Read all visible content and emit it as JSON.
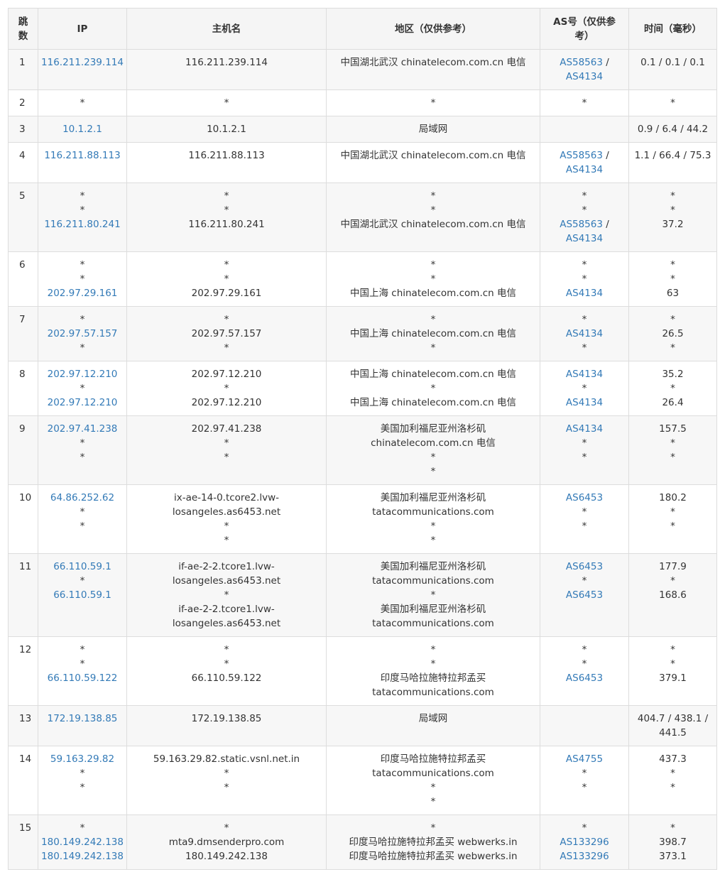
{
  "headers": {
    "hop": "跳数",
    "ip": "IP",
    "host": "主机名",
    "region": "地区（仅供参考）",
    "as": "AS号（仅供参考）",
    "time": "时间（毫秒）"
  },
  "rows": [
    {
      "hop": "1",
      "ip": [
        "116.211.239.114"
      ],
      "host": [
        "116.211.239.114"
      ],
      "region": [
        "中国湖北武汉 chinatelecom.com.cn 电信"
      ],
      "as": [
        [
          "AS58563 /",
          "AS4134"
        ]
      ],
      "time": [
        "0.1 / 0.1 / 0.1"
      ]
    },
    {
      "hop": "2",
      "ip": [
        "*"
      ],
      "host": [
        "*"
      ],
      "region": [
        "*"
      ],
      "as": [
        [
          "*"
        ]
      ],
      "time": [
        "*"
      ]
    },
    {
      "hop": "3",
      "ip": [
        "10.1.2.1"
      ],
      "host": [
        "10.1.2.1"
      ],
      "region": [
        "局域网"
      ],
      "as": [
        [
          ""
        ]
      ],
      "time": [
        "0.9 / 6.4 / 44.2"
      ]
    },
    {
      "hop": "4",
      "ip": [
        "116.211.88.113"
      ],
      "host": [
        "116.211.88.113"
      ],
      "region": [
        "中国湖北武汉 chinatelecom.com.cn 电信"
      ],
      "as": [
        [
          "AS58563 /",
          "AS4134"
        ]
      ],
      "time": [
        "1.1 / 66.4 / 75.3"
      ]
    },
    {
      "hop": "5",
      "ip": [
        "*",
        "*",
        "116.211.80.241"
      ],
      "host": [
        "*",
        "*",
        "116.211.80.241"
      ],
      "region": [
        "*",
        "*",
        "中国湖北武汉 chinatelecom.com.cn 电信"
      ],
      "as": [
        [
          "*"
        ],
        [
          "*"
        ],
        [
          "AS58563 /",
          "AS4134"
        ]
      ],
      "time": [
        "*",
        "*",
        "37.2"
      ]
    },
    {
      "hop": "6",
      "ip": [
        "*",
        "*",
        "202.97.29.161"
      ],
      "host": [
        "*",
        "*",
        "202.97.29.161"
      ],
      "region": [
        "*",
        "*",
        "中国上海 chinatelecom.com.cn 电信"
      ],
      "as": [
        [
          "*"
        ],
        [
          "*"
        ],
        [
          "AS4134"
        ]
      ],
      "time": [
        "*",
        "*",
        "63"
      ]
    },
    {
      "hop": "7",
      "ip": [
        "*",
        "202.97.57.157",
        "*"
      ],
      "host": [
        "*",
        "202.97.57.157",
        "*"
      ],
      "region": [
        "*",
        "中国上海 chinatelecom.com.cn 电信",
        "*"
      ],
      "as": [
        [
          "*"
        ],
        [
          "AS4134"
        ],
        [
          "*"
        ]
      ],
      "time": [
        "*",
        "26.5",
        "*"
      ]
    },
    {
      "hop": "8",
      "ip": [
        "202.97.12.210",
        "*",
        "202.97.12.210"
      ],
      "host": [
        "202.97.12.210",
        "*",
        "202.97.12.210"
      ],
      "region": [
        "中国上海 chinatelecom.com.cn 电信",
        "*",
        "中国上海 chinatelecom.com.cn 电信"
      ],
      "as": [
        [
          "AS4134"
        ],
        [
          "*"
        ],
        [
          "AS4134"
        ]
      ],
      "time": [
        "35.2",
        "*",
        "26.4"
      ]
    },
    {
      "hop": "9",
      "ip": [
        "202.97.41.238",
        "*",
        "*"
      ],
      "host": [
        "202.97.41.238",
        "*",
        "*"
      ],
      "region": [
        "美国加利福尼亚州洛杉矶",
        "chinatelecom.com.cn 电信",
        "*",
        "*"
      ],
      "as": [
        [
          "AS4134"
        ],
        [
          "*"
        ],
        [
          "*"
        ]
      ],
      "time": [
        "157.5",
        "*",
        "*"
      ]
    },
    {
      "hop": "10",
      "ip": [
        "64.86.252.62",
        "*",
        "*"
      ],
      "host": [
        "ix-ae-14-0.tcore2.lvw-",
        "losangeles.as6453.net",
        "*",
        "*"
      ],
      "region": [
        "美国加利福尼亚州洛杉矶",
        "tatacommunications.com",
        "*",
        "*"
      ],
      "as": [
        [
          "AS6453"
        ],
        [
          "*"
        ],
        [
          "*"
        ]
      ],
      "time": [
        "180.2",
        "*",
        "*"
      ]
    },
    {
      "hop": "11",
      "ip": [
        "66.110.59.1",
        "*",
        "66.110.59.1"
      ],
      "host": [
        "if-ae-2-2.tcore1.lvw-",
        "losangeles.as6453.net",
        "*",
        "if-ae-2-2.tcore1.lvw-",
        "losangeles.as6453.net"
      ],
      "region": [
        "美国加利福尼亚州洛杉矶",
        "tatacommunications.com",
        "*",
        "美国加利福尼亚州洛杉矶",
        "tatacommunications.com"
      ],
      "as": [
        [
          "AS6453"
        ],
        [
          "*"
        ],
        [
          "AS6453"
        ]
      ],
      "time": [
        "177.9",
        "*",
        "168.6"
      ]
    },
    {
      "hop": "12",
      "ip": [
        "*",
        "*",
        "66.110.59.122"
      ],
      "host": [
        "*",
        "*",
        "66.110.59.122"
      ],
      "region": [
        "*",
        "*",
        "印度马哈拉施特拉邦孟买",
        "tatacommunications.com"
      ],
      "as": [
        [
          "*"
        ],
        [
          "*"
        ],
        [
          "AS6453"
        ]
      ],
      "time": [
        "*",
        "*",
        "379.1"
      ]
    },
    {
      "hop": "13",
      "ip": [
        "172.19.138.85"
      ],
      "host": [
        "172.19.138.85"
      ],
      "region": [
        "局域网"
      ],
      "as": [
        [
          ""
        ]
      ],
      "time": [
        "404.7 / 438.1 /",
        "441.5"
      ]
    },
    {
      "hop": "14",
      "ip": [
        "59.163.29.82",
        "*",
        "*"
      ],
      "host": [
        "59.163.29.82.static.vsnl.net.in",
        "*",
        "*"
      ],
      "region": [
        "印度马哈拉施特拉邦孟买",
        "tatacommunications.com",
        "*",
        "*"
      ],
      "as": [
        [
          "AS4755"
        ],
        [
          "*"
        ],
        [
          "*"
        ]
      ],
      "time": [
        "437.3",
        "*",
        "*"
      ]
    },
    {
      "hop": "15",
      "ip": [
        "*",
        "180.149.242.138",
        "180.149.242.138"
      ],
      "host": [
        "*",
        "mta9.dmsenderpro.com",
        "180.149.242.138"
      ],
      "region": [
        "*",
        "印度马哈拉施特拉邦孟买 webwerks.in",
        "印度马哈拉施特拉邦孟买 webwerks.in"
      ],
      "as": [
        [
          "*"
        ],
        [
          "AS133296"
        ],
        [
          "AS133296"
        ]
      ],
      "time": [
        "*",
        "398.7",
        "373.1"
      ]
    }
  ],
  "row_heights": {},
  "colors": {
    "link": "#337ab7",
    "border": "#dddddd",
    "stripe": "#f7f7f7",
    "header_bg": "#f5f5f5",
    "text": "#333333"
  }
}
